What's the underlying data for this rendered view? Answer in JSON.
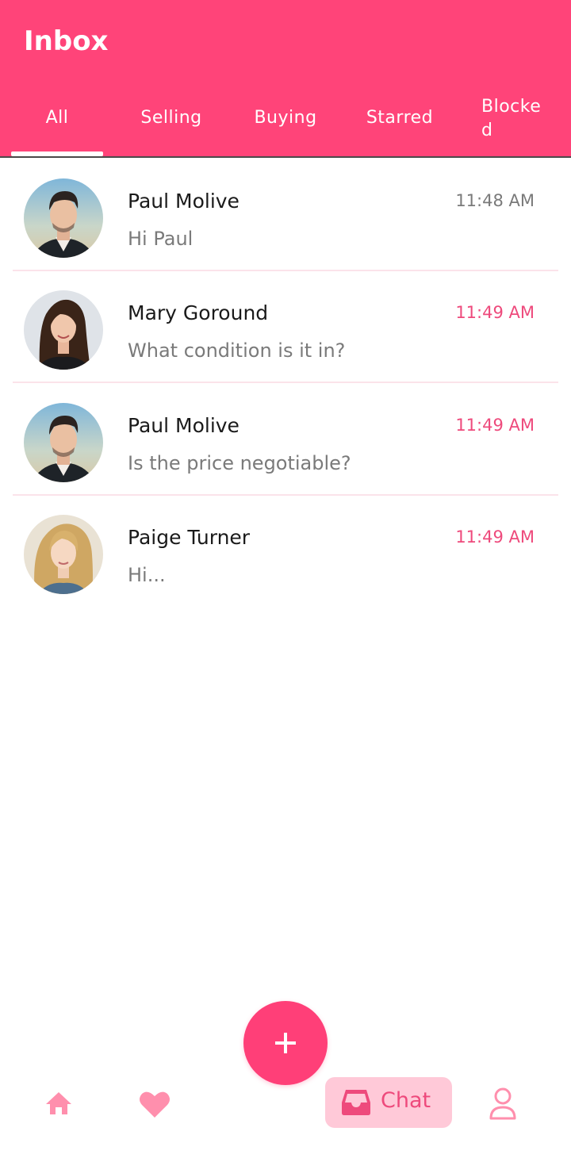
{
  "appbar": {
    "title": "Inbox"
  },
  "tabs": [
    {
      "label": "All"
    },
    {
      "label": "Selling"
    },
    {
      "label": "Buying"
    },
    {
      "label": "Starred"
    },
    {
      "label": "Blocked"
    }
  ],
  "conversations": [
    {
      "name": "Paul Molive",
      "message": "Hi Paul",
      "time": "11:48 AM",
      "unread": false,
      "avatar": "male-avatar"
    },
    {
      "name": "Mary Goround",
      "message": "What condition is it in?",
      "time": "11:49 AM",
      "unread": true,
      "avatar": "female-avatar"
    },
    {
      "name": "Paul Molive",
      "message": "Is the price negotiable?",
      "time": "11:49 AM",
      "unread": true,
      "avatar": "male-avatar"
    },
    {
      "name": "Paige Turner",
      "message": "Hi...",
      "time": "11:49 AM",
      "unread": true,
      "avatar": "blonde-avatar"
    }
  ],
  "fab": {
    "icon": "plus-icon"
  },
  "bottom_nav": {
    "items": [
      {
        "icon": "home-icon"
      },
      {
        "icon": "heart-icon"
      },
      {
        "icon": "inbox-icon",
        "label": "Chat",
        "active": true
      },
      {
        "icon": "person-icon"
      }
    ]
  },
  "colors": {
    "primary": "#ff4479",
    "accent": "#ee4a7c",
    "chip": "#ffc9d8",
    "muted": "#7a7a7a"
  }
}
